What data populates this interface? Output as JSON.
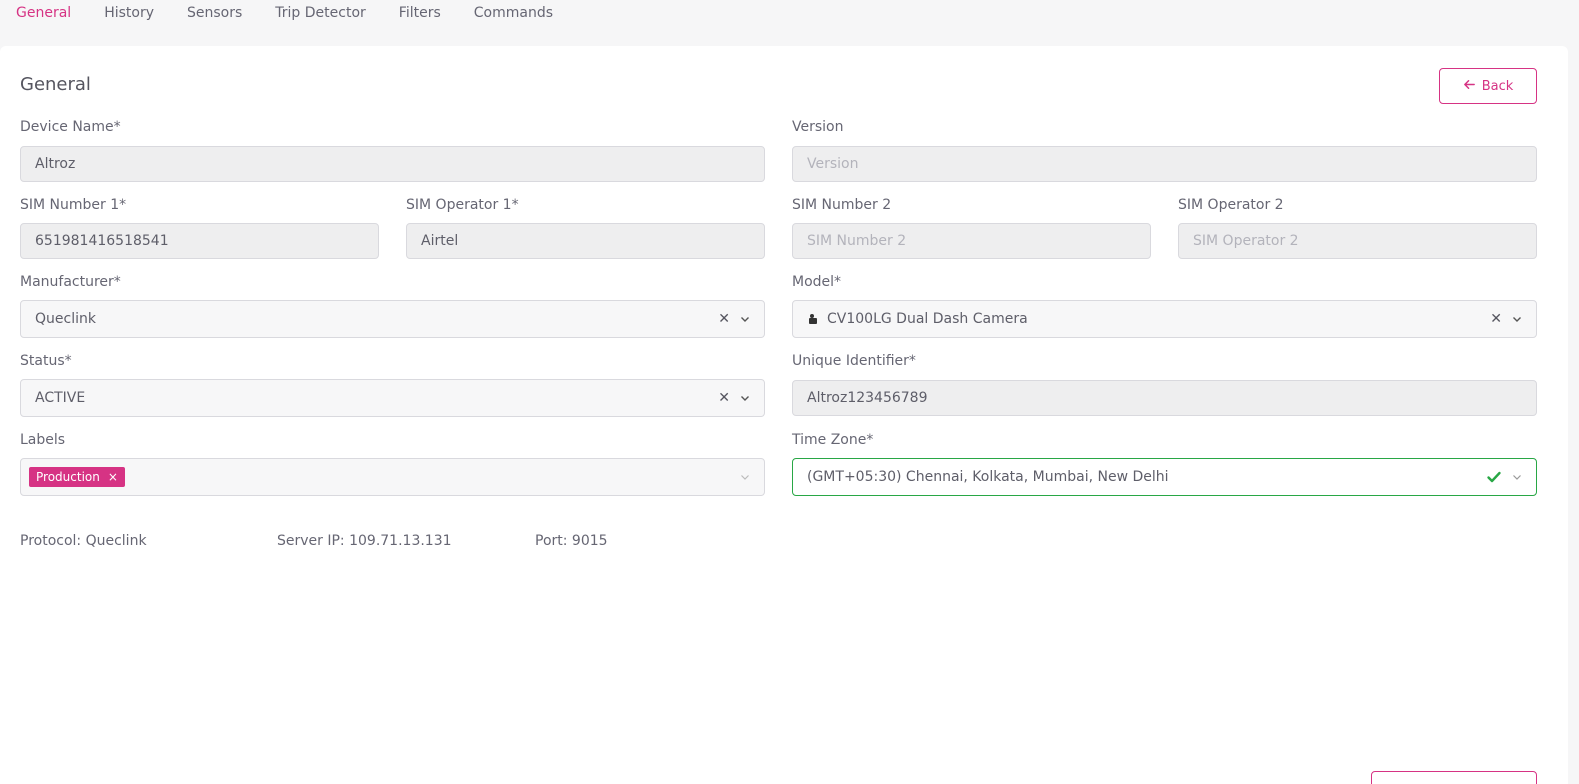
{
  "tabs": [
    {
      "label": "General",
      "active": true
    },
    {
      "label": "History"
    },
    {
      "label": "Sensors"
    },
    {
      "label": "Trip Detector"
    },
    {
      "label": "Filters"
    },
    {
      "label": "Commands"
    }
  ],
  "card": {
    "title": "General",
    "back_label": "Back"
  },
  "form": {
    "device_name": {
      "label": "Device Name*",
      "value": "Altroz"
    },
    "version": {
      "label": "Version",
      "placeholder": "Version"
    },
    "sim1": {
      "label": "SIM Number 1*",
      "value": "651981416518541"
    },
    "sim_op1": {
      "label": "SIM Operator 1*",
      "value": "Airtel"
    },
    "sim2": {
      "label": "SIM Number 2",
      "placeholder": "SIM Number 2"
    },
    "sim_op2": {
      "label": "SIM Operator 2",
      "placeholder": "SIM Operator 2"
    },
    "manufacturer": {
      "label": "Manufacturer*",
      "value": "Queclink"
    },
    "model": {
      "label": "Model*",
      "value": "CV100LG Dual Dash Camera",
      "icon": "camera-icon"
    },
    "status": {
      "label": "Status*",
      "value": "ACTIVE"
    },
    "unique_id": {
      "label": "Unique Identifier*",
      "value": "Altroz123456789"
    },
    "labels": {
      "label": "Labels",
      "chips": [
        "Production"
      ]
    },
    "time_zone": {
      "label": "Time Zone*",
      "value": "(GMT+05:30) Chennai, Kolkata, Mumbai, New Delhi"
    }
  },
  "info": {
    "protocol": "Protocol: Queclink",
    "server_ip": "Server IP: 109.71.13.131",
    "port": "Port: 9015"
  },
  "colors": {
    "accent": "#d63384",
    "valid": "#28a745"
  }
}
